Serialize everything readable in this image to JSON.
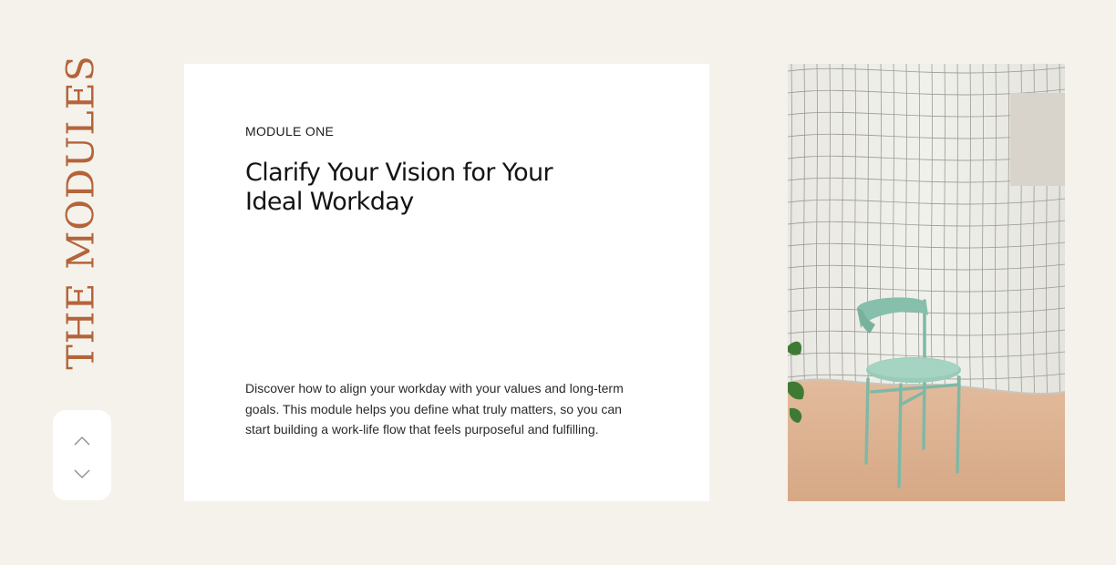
{
  "section": {
    "vertical_title": "THE MODULES"
  },
  "nav": {
    "up_icon": "chevron-up-icon",
    "down_icon": "chevron-down-icon"
  },
  "module": {
    "label": "MODULE ONE",
    "heading": "Clarify Your Vision for Your Ideal Workday",
    "description": "Discover how to align your workday with your values and long-term goals. This module helps you define what truly matters, so you can start building a work-life flow that feels purposeful and fulfilling."
  },
  "image": {
    "subject": "mint green chair against curved white tiled wall"
  },
  "colors": {
    "background": "#f5f2ec",
    "accent": "#b4643a",
    "card": "#ffffff",
    "chair": "#8cc4b2"
  }
}
